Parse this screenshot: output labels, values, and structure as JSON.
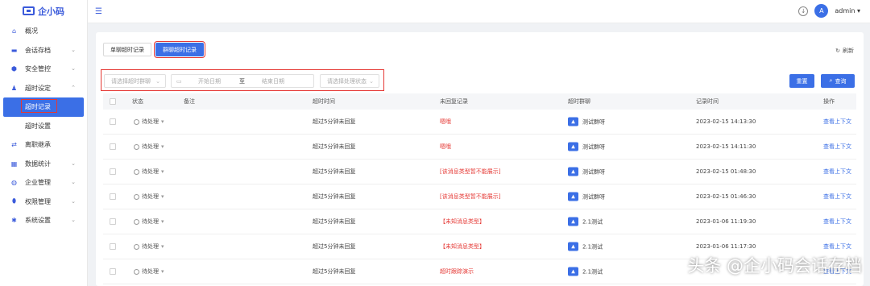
{
  "app": {
    "logo_text": "企小码"
  },
  "sidebar": {
    "items": [
      {
        "label": "概况",
        "chevron": ""
      },
      {
        "label": "会话存档",
        "chevron": "⌄"
      },
      {
        "label": "安全管控",
        "chevron": "⌄"
      },
      {
        "label": "超时设定",
        "chevron": "⌃"
      },
      {
        "label": "离职继承",
        "chevron": ""
      },
      {
        "label": "数据统计",
        "chevron": "⌄"
      },
      {
        "label": "企业管理",
        "chevron": "⌄"
      },
      {
        "label": "权限管理",
        "chevron": "⌄"
      },
      {
        "label": "系统设置",
        "chevron": "⌄"
      }
    ],
    "sub_items": [
      {
        "label": "超时记录"
      },
      {
        "label": "超时设置"
      }
    ]
  },
  "topbar": {
    "user": "admin",
    "avatar_letter": "A"
  },
  "tabs": [
    {
      "label": "单聊超时记录"
    },
    {
      "label": "群聊超时记录"
    }
  ],
  "refresh_label": "刷新",
  "filters": {
    "group_placeholder": "请选择超时群聊",
    "start_placeholder": "开始日期",
    "range_sep": "至",
    "end_placeholder": "结束日期",
    "status_placeholder": "请选择处理状态"
  },
  "buttons": {
    "reset": "重置",
    "search": "查询"
  },
  "table": {
    "columns": [
      "状态",
      "备注",
      "超时时间",
      "未回复记录",
      "超时群聊",
      "记录时间",
      "操作"
    ],
    "rows": [
      {
        "status": "待处理",
        "note": "",
        "timeout": "超过5分钟未回复",
        "record": "嗯哦",
        "group": "测试群呀",
        "time": "2023-02-15 14:13:30",
        "action": "查看上下文"
      },
      {
        "status": "待处理",
        "note": "",
        "timeout": "超过5分钟未回复",
        "record": "嗯哦",
        "group": "测试群呀",
        "time": "2023-02-15 14:11:30",
        "action": "查看上下文"
      },
      {
        "status": "待处理",
        "note": "",
        "timeout": "超过5分钟未回复",
        "record": "[该消息类型暂不能展示]",
        "group": "测试群呀",
        "time": "2023-02-15 01:48:30",
        "action": "查看上下文"
      },
      {
        "status": "待处理",
        "note": "",
        "timeout": "超过5分钟未回复",
        "record": "[该消息类型暂不能展示]",
        "group": "测试群呀",
        "time": "2023-02-15 01:46:30",
        "action": "查看上下文"
      },
      {
        "status": "待处理",
        "note": "",
        "timeout": "超过5分钟未回复",
        "record": "【未知消息类型】",
        "group": "2.1测试",
        "time": "2023-01-06 11:19:30",
        "action": "查看上下文"
      },
      {
        "status": "待处理",
        "note": "",
        "timeout": "超过5分钟未回复",
        "record": "【未知消息类型】",
        "group": "2.1测试",
        "time": "2023-01-06 11:17:30",
        "action": "查看上下文"
      },
      {
        "status": "待处理",
        "note": "",
        "timeout": "超过5分钟未回复",
        "record": "超时跟踪演示",
        "group": "2.1测试",
        "time": "",
        "action": "查看上下文"
      }
    ]
  },
  "watermark": "头条 @企小码会话存档"
}
